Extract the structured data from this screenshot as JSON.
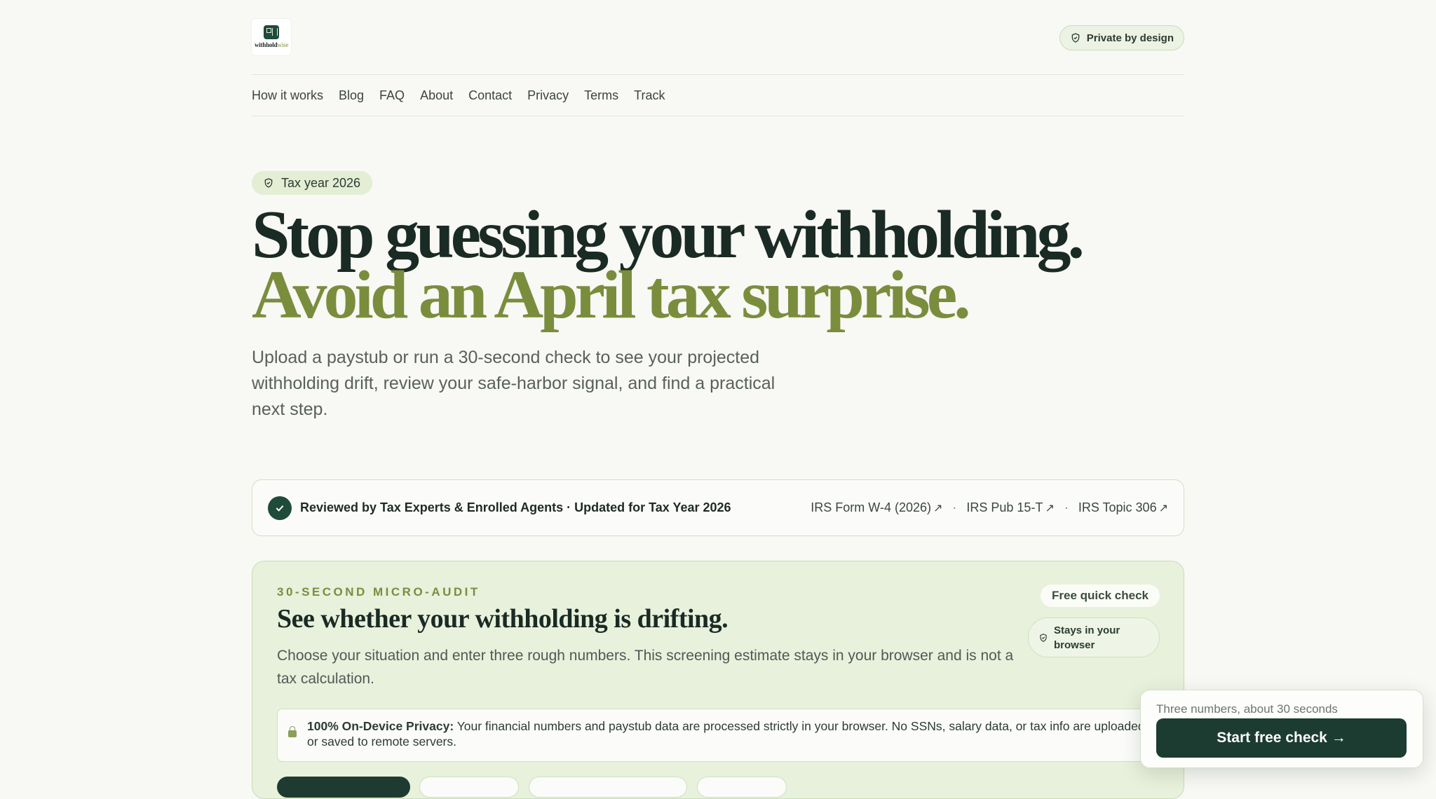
{
  "header": {
    "logo_text_bold": "withhold",
    "logo_text_accent": "wise",
    "private_label": "Private by design"
  },
  "nav": {
    "items": [
      "How it works",
      "Blog",
      "FAQ",
      "About",
      "Contact",
      "Privacy",
      "Terms",
      "Track"
    ]
  },
  "hero": {
    "badge": "Tax year 2026",
    "headline_main": "Stop guessing your withholding.",
    "headline_accent": "Avoid an April tax surprise.",
    "lede": "Upload a paystub or run a 30-second check to see your projected withholding drift, review your safe-harbor signal, and find a practical next step."
  },
  "trust": {
    "text": "Reviewed by Tax Experts & Enrolled Agents · Updated for Tax Year 2026",
    "links": [
      "IRS Form W-4 (2026)",
      "IRS Pub 15-T",
      "IRS Topic 306"
    ],
    "separator": "·",
    "arrow": "↗"
  },
  "audit": {
    "eyebrow": "30-SECOND MICRO-AUDIT",
    "title": "See whether your withholding is drifting.",
    "description": "Choose your situation and enter three rough numbers. This screening estimate stays in your browser and is not a tax calculation.",
    "free_pill": "Free quick check",
    "stays_pill": "Stays in your browser",
    "privacy_bold": "100% On-Device Privacy:",
    "privacy_text": " Your financial numbers and paystub data are processed strictly in your browser. No SSNs, salary data, or tax info are uploaded or saved to remote servers."
  },
  "cta": {
    "hint": "Three numbers, about 30 seconds",
    "button": "Start free check →"
  },
  "colors": {
    "accent_olive": "#7a8d3d",
    "brand_dark_green": "#1c3b31",
    "card_green": "#e8f1dc"
  }
}
